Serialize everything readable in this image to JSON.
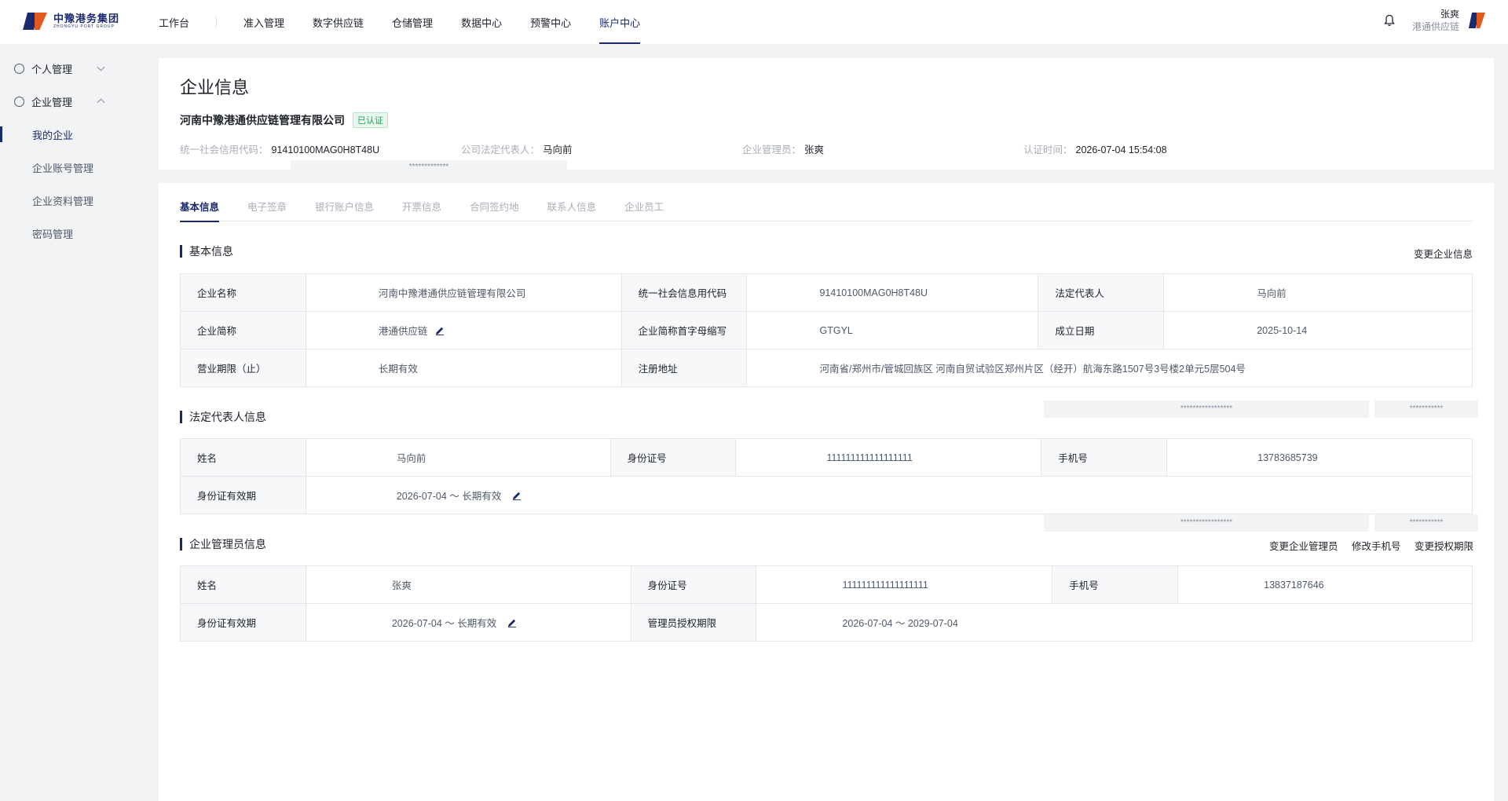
{
  "brand": {
    "name_cn": "中豫港务集团",
    "name_en": "ZHONGYU PORT GROUP"
  },
  "nav": {
    "workbench": "工作台",
    "items": [
      "准入管理",
      "数字供应链",
      "仓储管理",
      "数据中心",
      "预警中心",
      "账户中心"
    ],
    "active": "账户中心"
  },
  "user": {
    "name": "张爽",
    "org": "港通供应链"
  },
  "sidebar": {
    "groups": [
      {
        "label": "个人管理",
        "icon": "user-circle-icon",
        "expanded": false
      },
      {
        "label": "企业管理",
        "icon": "enterprise-icon",
        "expanded": true
      }
    ],
    "items": [
      "我的企业",
      "企业账号管理",
      "企业资料管理",
      "密码管理"
    ],
    "active_item": "我的企业"
  },
  "header": {
    "title": "企业信息",
    "company_name": "河南中豫港通供应链管理有限公司",
    "badge": "已认证",
    "credit_code_label": "统一社会信用代码：",
    "credit_code": "91410100MAG0H8T48U",
    "legal_rep_label": "公司法定代表人：",
    "legal_rep": "马向前",
    "admin_label": "企业管理员：",
    "admin": "张爽",
    "cert_time_label": "认证时间：",
    "cert_time": "2026-07-04 15:54:08",
    "masked": "*************"
  },
  "tabs": [
    "基本信息",
    "电子签章",
    "银行账户信息",
    "开票信息",
    "合同签约地",
    "联系人信息",
    "企业员工"
  ],
  "active_tab": "基本信息",
  "basic": {
    "title": "基本信息",
    "action": "变更企业信息",
    "rows": [
      [
        {
          "label": "企业名称",
          "value": "河南中豫港通供应链管理有限公司"
        },
        {
          "label": "统一社会信息用代码",
          "value": "91410100MAG0H8T48U"
        },
        {
          "label": "法定代表人",
          "value": "马向前"
        }
      ],
      [
        {
          "label": "企业简称",
          "value": "港通供应链"
        },
        {
          "label": "企业简称首字母缩写",
          "value": "GTGYL"
        },
        {
          "label": "成立日期",
          "value": "2025-10-14"
        }
      ],
      [
        {
          "label": "营业期限（止）",
          "value": "长期有效"
        },
        {
          "label": "注册地址",
          "value": "河南省/郑州市/管城回族区 河南自贸试验区郑州片区（经开）航海东路1507号3号楼2单元5层504号"
        }
      ]
    ]
  },
  "legal": {
    "title": "法定代表人信息",
    "masked_a": "*****************",
    "masked_b": "***********",
    "name_label": "姓名",
    "name": "马向前",
    "id_label": "身份证号",
    "id": "111111111111111111",
    "phone_label": "手机号",
    "phone": "13783685739",
    "validity_label": "身份证有效期",
    "validity": "2026-07-04 ～ 长期有效"
  },
  "admin": {
    "title": "企业管理员信息",
    "masked_a": "*****************",
    "masked_b": "***********",
    "actions": [
      "变更企业管理员",
      "修改手机号",
      "变更授权期限"
    ],
    "name_label": "姓名",
    "name": "张爽",
    "id_label": "身份证号",
    "id": "111111111111111111",
    "phone_label": "手机号",
    "phone": "13837187646",
    "validity_label": "身份证有效期",
    "validity": "2026-07-04 ～ 长期有效",
    "auth_label": "管理员授权期限",
    "auth": "2026-07-04 ～ 2029-07-04"
  },
  "colors": {
    "brand": "#1a2a6c",
    "accent": "#e0591f",
    "verified": "#23a05b"
  }
}
